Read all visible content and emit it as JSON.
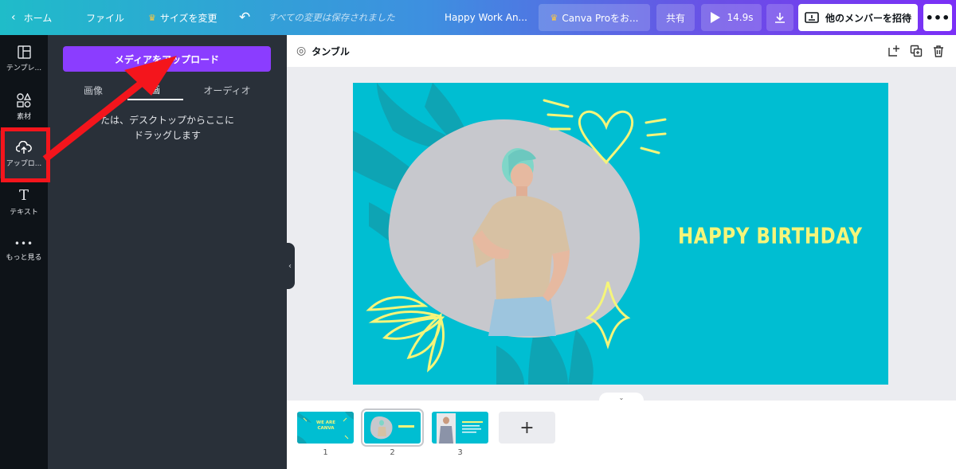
{
  "topbar": {
    "home": "ホーム",
    "file": "ファイル",
    "resize": "サイズを変更",
    "saved_status": "すべての変更は保存されました",
    "doc_title": "Happy Work An...",
    "pro": "Canva Proをお...",
    "share": "共有",
    "play_time": "14.9s",
    "invite": "他のメンバーを招待",
    "more": "•••"
  },
  "rail": {
    "items": [
      {
        "label": "テンプレ..."
      },
      {
        "label": "素材"
      },
      {
        "label": "アップロ..."
      },
      {
        "label": "テキスト"
      },
      {
        "label": "もっと見る"
      }
    ]
  },
  "panel": {
    "upload_button": "メディアをアップロード",
    "tabs": [
      "画像",
      "画",
      "オーディオ"
    ],
    "drop_line1": "たは、デスクトップからここに",
    "drop_line2": "ドラッグします"
  },
  "canvas": {
    "page_label": "タンブル",
    "design_text": "HAPPY BIRTHDAY"
  },
  "filmstrip": {
    "thumbs": [
      {
        "number": "1",
        "text_lines": [
          "WE ARE",
          "CANVA"
        ]
      },
      {
        "number": "2"
      },
      {
        "number": "3"
      }
    ],
    "add": "+"
  },
  "colors": {
    "accent_purple": "#8b3dff",
    "design_bg": "#00bed2",
    "design_text": "#f5f57a",
    "annotation_red": "#f4151c"
  }
}
